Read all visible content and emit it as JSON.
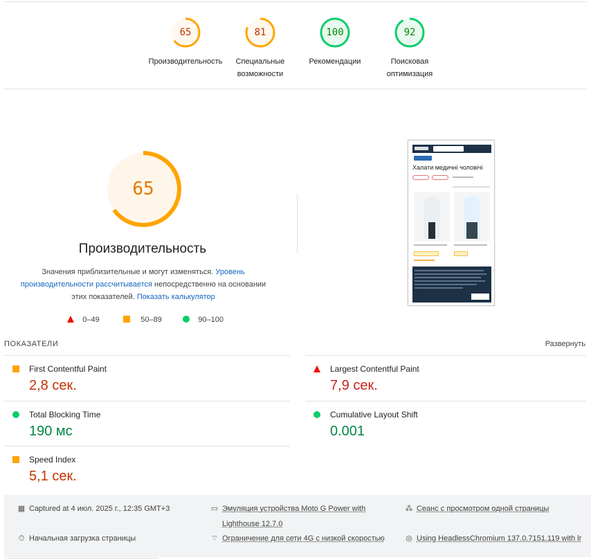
{
  "scores": [
    {
      "value": "65",
      "label": "Производительность",
      "status": "average",
      "color": "#ffa400"
    },
    {
      "value": "81",
      "label": "Специальные возможности",
      "status": "average",
      "color": "#ffa400"
    },
    {
      "value": "100",
      "label": "Рекомендации",
      "status": "pass",
      "color": "#0cce6b"
    },
    {
      "value": "92",
      "label": "Поисковая оптимизация",
      "status": "pass",
      "color": "#0cce6b"
    }
  ],
  "main": {
    "score": "65",
    "title": "Производительность",
    "desc_text_1": "Значения приблизительные и могут изменяться.",
    "desc_link_1": "Уровень производительности рассчитывается",
    "desc_text_2": "непосредственно на основании этих показателей.",
    "desc_link_2": "Показать калькулятор"
  },
  "legend": [
    {
      "range": "0–49",
      "shape": "triangle-icon",
      "color": "#eb0f00"
    },
    {
      "range": "50–89",
      "shape": "square-icon",
      "color": "#ffa400"
    },
    {
      "range": "90–100",
      "shape": "circle-icon",
      "color": "#0cce6b"
    }
  ],
  "thumbnail": {
    "page_heading": "Халати медичні чоловічі"
  },
  "metrics": {
    "title": "ПОКАЗАТЕЛИ",
    "expand_label": "Развернуть",
    "items": [
      {
        "name": "First Contentful Paint",
        "value": "2,8 сек.",
        "status": "average"
      },
      {
        "name": "Largest Contentful Paint",
        "value": "7,9 сек.",
        "status": "fail"
      },
      {
        "name": "Total Blocking Time",
        "value": "190 мс",
        "status": "pass"
      },
      {
        "name": "Cumulative Layout Shift",
        "value": "0.001",
        "status": "pass"
      },
      {
        "name": "Speed Index",
        "value": "5,1 сек.",
        "status": "average"
      }
    ]
  },
  "footer": {
    "captured": "Captured at 4 июл. 2025 г., 12:35 GMT+3",
    "device_line1": "Эмуляция устройства Moto G Power with",
    "device_line2": "Lighthouse 12.7.0",
    "session": "Сеанс с просмотром одной страницы",
    "initial_load": "Начальная загрузка страницы",
    "throttling": "Ограничение для сети 4G с низкой скоростью",
    "browser": "Using HeadlessChromium 137.0.7151.119 with lr"
  }
}
